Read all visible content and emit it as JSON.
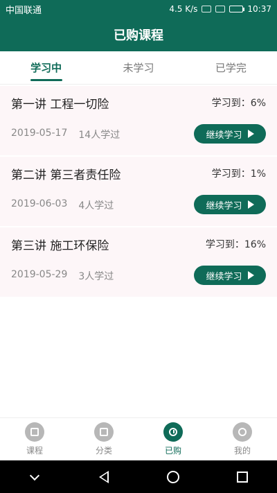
{
  "status_bar": {
    "carrier": "中国联通",
    "speed": "4.5 K/s",
    "time": "10:37"
  },
  "header": {
    "title": "已购课程"
  },
  "tabs": [
    {
      "label": "学习中",
      "active": true
    },
    {
      "label": "未学习",
      "active": false
    },
    {
      "label": "已学完",
      "active": false
    }
  ],
  "courses": [
    {
      "title": "第一讲 工程一切险",
      "progress": "学习到：6%",
      "date": "2019-05-17",
      "learners": "14人学过",
      "button": "继续学习"
    },
    {
      "title": "第二讲 第三者责任险",
      "progress": "学习到：1%",
      "date": "2019-06-03",
      "learners": "4人学过",
      "button": "继续学习"
    },
    {
      "title": "第三讲 施工环保险",
      "progress": "学习到：16%",
      "date": "2019-05-29",
      "learners": "3人学过",
      "button": "继续学习"
    }
  ],
  "bottom_nav": [
    {
      "label": "课程",
      "icon": "book-play-icon",
      "active": false
    },
    {
      "label": "分类",
      "icon": "bookmark-icon",
      "active": false
    },
    {
      "label": "已购",
      "icon": "clock-icon",
      "active": true
    },
    {
      "label": "我的",
      "icon": "profile-card-icon",
      "active": false
    }
  ],
  "colors": {
    "primary": "#0f6b58",
    "card_bg": "#fdf6f8"
  }
}
